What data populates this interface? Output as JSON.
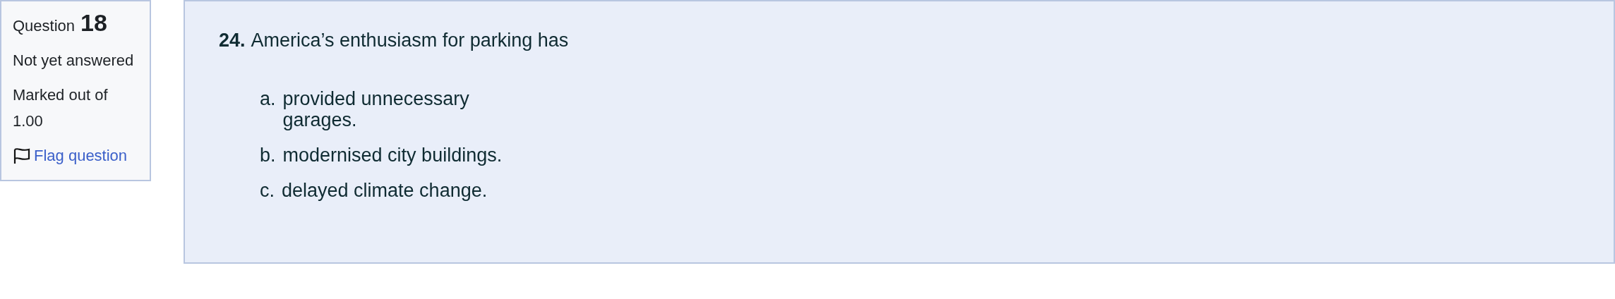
{
  "info": {
    "label": "Question",
    "number": "18",
    "status": "Not yet answered",
    "marks": "Marked out of 1.00",
    "flag": {
      "label": "Flag question",
      "flagged": false
    }
  },
  "question": {
    "number": "24.",
    "text": "America’s enthusiasm for parking has",
    "options": [
      {
        "letter": "a.",
        "text": "provided unnecessary garages."
      },
      {
        "letter": "b.",
        "text": "modernised city buildings."
      },
      {
        "letter": "c.",
        "text": "delayed climate change."
      }
    ]
  }
}
